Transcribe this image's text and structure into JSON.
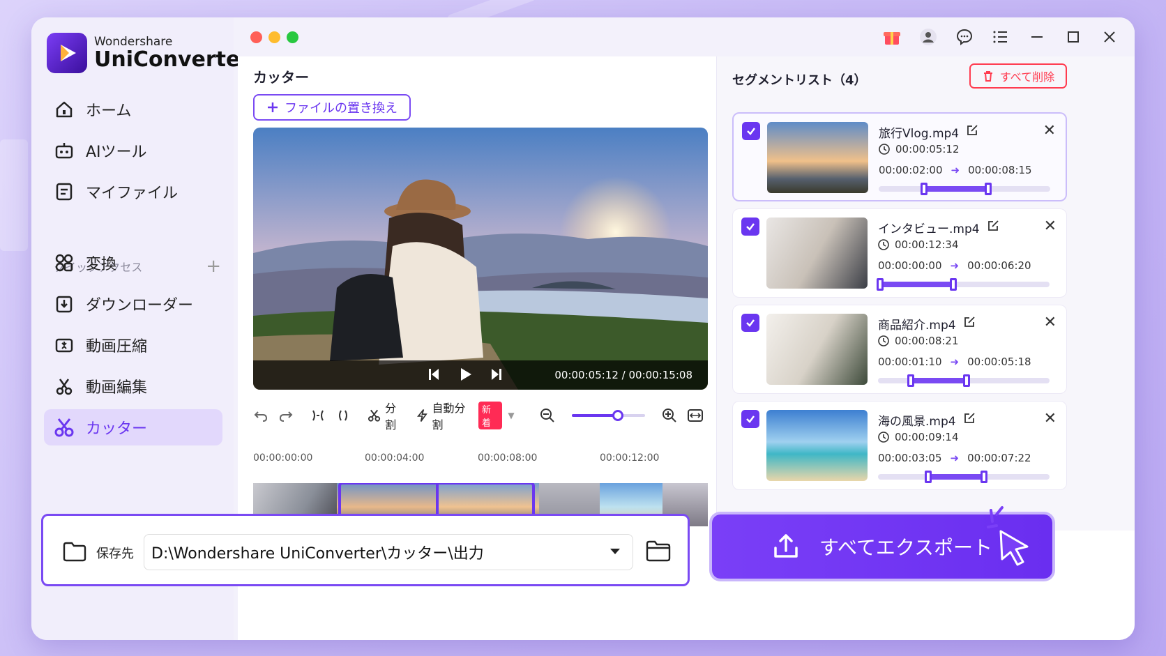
{
  "app": {
    "brand": "Wondershare",
    "product": "UniConverter"
  },
  "sidebar": {
    "items": [
      {
        "label": "ホーム",
        "icon": "home-icon"
      },
      {
        "label": "AIツール",
        "icon": "ai-tools-icon"
      },
      {
        "label": "マイファイル",
        "icon": "my-files-icon"
      }
    ],
    "quick_access_label": "クイックアクセス",
    "quick_items": [
      {
        "label": "変換",
        "icon": "convert-icon"
      },
      {
        "label": "ダウンローダー",
        "icon": "downloader-icon"
      },
      {
        "label": "動画圧縮",
        "icon": "compress-icon"
      },
      {
        "label": "動画編集",
        "icon": "edit-icon"
      },
      {
        "label": "カッター",
        "icon": "scissors-icon",
        "active": true
      }
    ]
  },
  "cutter": {
    "title": "カッター",
    "replace_button": "ファイルの置き換え",
    "current_time": "00:00:05:12",
    "total_time": "00:00:15:08",
    "toolbar": {
      "split": "分割",
      "auto_split": "自動分割",
      "new_badge": "新着",
      "zoom_level": 0.6
    },
    "ruler": [
      "00:00:00:00",
      "00:00:04:00",
      "00:00:08:00",
      "00:00:12:00"
    ]
  },
  "segments": {
    "title": "セグメントリスト（4）",
    "delete_all": "すべて削除",
    "items": [
      {
        "name": "旅行Vlog.mp4",
        "duration": "00:00:05:12",
        "start": "00:00:02:00",
        "end": "00:00:08:15",
        "range": [
          0.25,
          0.65
        ]
      },
      {
        "name": "インタビュー.mp4",
        "duration": "00:00:12:34",
        "start": "00:00:00:00",
        "end": "00:00:06:20",
        "range": [
          0.0,
          0.45
        ]
      },
      {
        "name": "商品紹介.mp4",
        "duration": "00:00:08:21",
        "start": "00:00:01:10",
        "end": "00:00:05:18",
        "range": [
          0.18,
          0.53
        ]
      },
      {
        "name": "海の風景.mp4",
        "duration": "00:00:09:14",
        "start": "00:00:03:05",
        "end": "00:00:07:22",
        "range": [
          0.28,
          0.63
        ]
      }
    ]
  },
  "save": {
    "label": "保存先",
    "path": "D:\\Wondershare UniConverter\\カッター\\出力"
  },
  "export_button": "すべてエクスポート",
  "colors": {
    "accent": "#6a36f0",
    "danger": "#ff3b4f"
  }
}
